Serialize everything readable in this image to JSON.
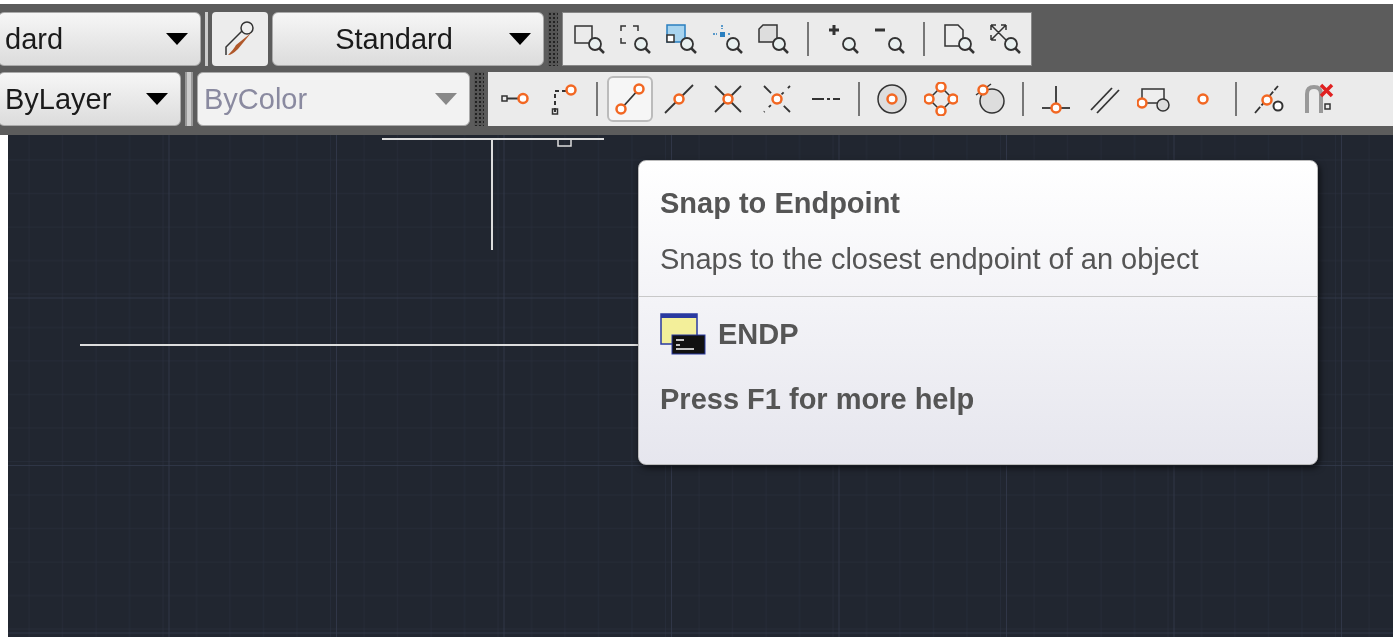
{
  "toolbar_row_1": {
    "dropdowns": [
      {
        "value": "dard",
        "disabled": false
      },
      {
        "value": "Standard",
        "disabled": false
      }
    ]
  },
  "toolbar_row_2": {
    "dropdowns": [
      {
        "value": "ByLayer",
        "disabled": false
      },
      {
        "value": "ByColor",
        "disabled": true
      }
    ]
  },
  "snap_toolbar": {
    "tools": [
      {
        "kind": "from",
        "selected": false
      },
      {
        "kind": "tracking",
        "selected": false
      },
      {
        "kind": "separator"
      },
      {
        "kind": "endpoint",
        "selected": true
      },
      {
        "kind": "midpoint",
        "selected": false
      },
      {
        "kind": "intersection",
        "selected": false
      },
      {
        "kind": "apparent",
        "selected": false
      },
      {
        "kind": "extension",
        "selected": false
      },
      {
        "kind": "separator"
      },
      {
        "kind": "center",
        "selected": false
      },
      {
        "kind": "quadrant",
        "selected": false
      },
      {
        "kind": "tangent",
        "selected": false
      },
      {
        "kind": "separator"
      },
      {
        "kind": "perpendicular",
        "selected": false
      },
      {
        "kind": "parallel",
        "selected": false
      },
      {
        "kind": "insert",
        "selected": false
      },
      {
        "kind": "node",
        "selected": false
      },
      {
        "kind": "separator"
      },
      {
        "kind": "nearest",
        "selected": false
      },
      {
        "kind": "none",
        "selected": false
      }
    ]
  },
  "tooltip": {
    "title": "Snap to Endpoint",
    "description": "Snaps to the closest endpoint of an object",
    "command": "ENDP",
    "help": "Press F1 for more help"
  }
}
